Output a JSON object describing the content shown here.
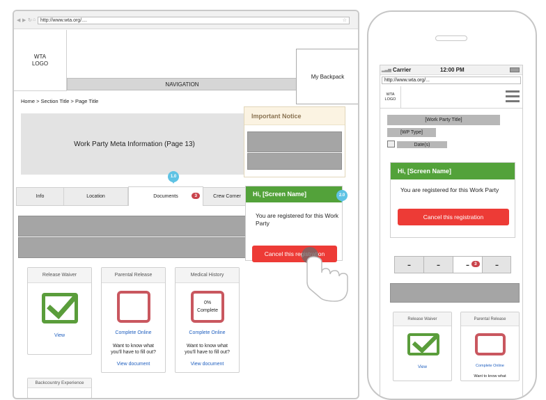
{
  "desktop": {
    "url": "http://www.wta.org/....",
    "logo_line1": "WTA",
    "logo_line2": "LOGO",
    "navigation": "NAVIGATION",
    "backpack": "My Backpack",
    "breadcrumb": "Home > Section Title > Page Title",
    "meta_info": "Work Party Meta Information (Page 13)",
    "tabs": [
      {
        "label": "Info"
      },
      {
        "label": "Location"
      },
      {
        "label": "Documents",
        "badge": "3"
      },
      {
        "label": "Crew Corner"
      }
    ],
    "pin1": "1.0",
    "pin2": "2.0",
    "notice_title": "Important Notice",
    "greeting": "Hi, [Screen Name]",
    "registered_text": "You are registered for this Work Party",
    "cancel_button": "Cancel this registration",
    "documents": [
      {
        "title": "Release Waiver",
        "link": "View"
      },
      {
        "title": "Parental Release",
        "link": "Complete Online",
        "note": "Want to know what you'll have to fill out?",
        "link2": "View document"
      },
      {
        "title": "Medical History",
        "progress_label": "0%",
        "progress_status": "Complete",
        "link": "Complete Online",
        "note": "Want to know what you'll have to fill out?",
        "link2": "View document"
      },
      {
        "title": "Backcountry Experience"
      }
    ]
  },
  "mobile": {
    "carrier": "Carrier",
    "time": "12:00 PM",
    "url": "http://www.wta.org/...",
    "logo_line1": "WTA",
    "logo_line2": "LOGO",
    "wp_title": "[Work Party Title]",
    "wp_type": "[WP Type]",
    "dates": "Date(s)",
    "greeting": "Hi, [Screen Name]",
    "registered_text": "You are registered for this Work Party",
    "cancel_button": "Cancel this registration",
    "tab_badge": "3",
    "documents": [
      {
        "title": "Release Waiver",
        "link": "View"
      },
      {
        "title": "Parental Release",
        "link": "Complete Online",
        "note": "Want to know what"
      }
    ]
  },
  "colors": {
    "green": "#53a23a",
    "red_button": "#ed3b36",
    "badge_red": "#c9434b",
    "pin_blue": "#5fc3e4",
    "link_blue": "#1f5fbf"
  },
  "progress": {
    "medical_history": 0
  }
}
